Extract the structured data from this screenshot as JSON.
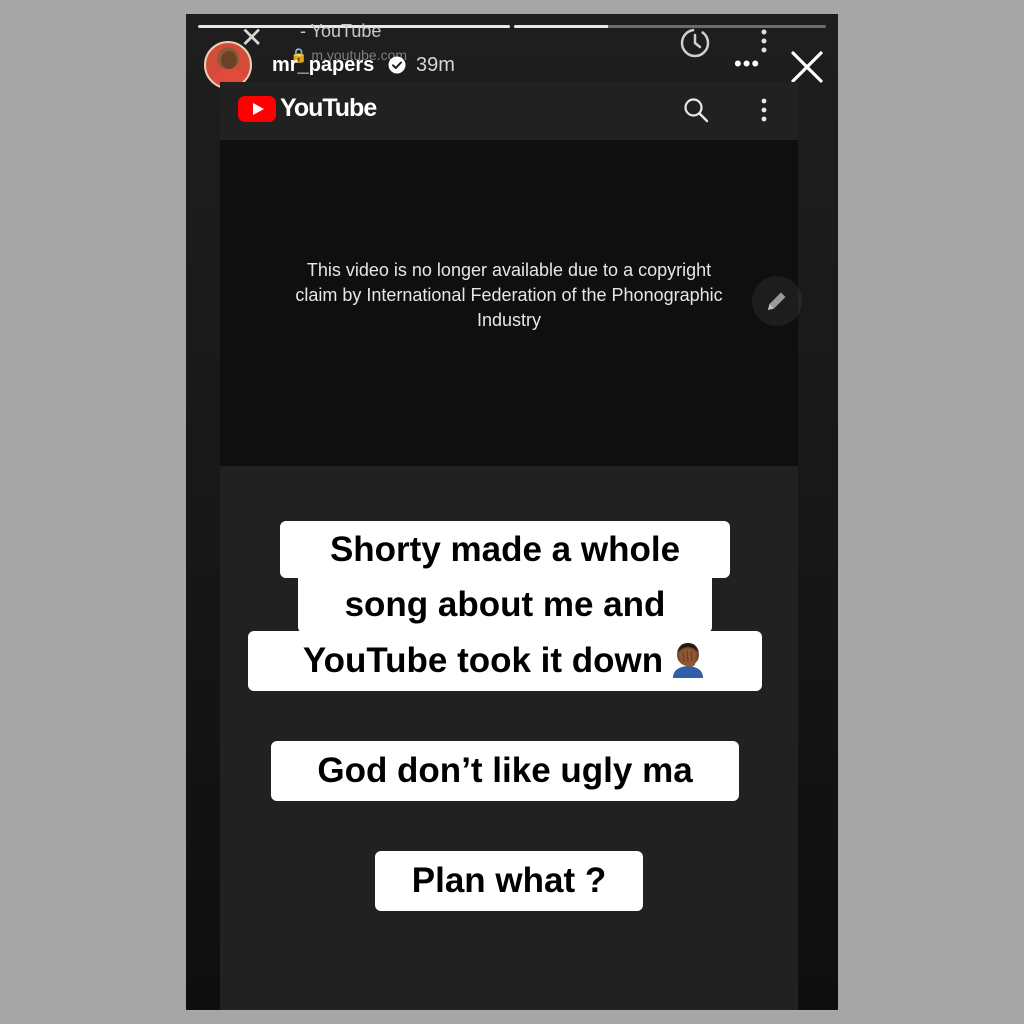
{
  "progress": [
    1,
    0.3
  ],
  "browser_chrome": {
    "tab_title": "- YouTube",
    "url": "m.youtube.com"
  },
  "story": {
    "username": "mr_papers",
    "time_ago": "39m",
    "verified": true
  },
  "youtube": {
    "logo_text": "YouTube",
    "player_message": "This video is no longer available due to a copyright claim by International Federation of the Phonographic Industry",
    "player_message_lines": [
      "This video is no longer available due to a copyright",
      "claim by International Federation of the Phonographic",
      "Industry"
    ]
  },
  "captions": [
    "Shorty made a whole",
    "song about me and",
    "YouTube took it down",
    "God don’t like ugly ma",
    "Plan what ?"
  ],
  "icons": {
    "more": "more-horizontal-icon",
    "close": "close-icon",
    "search": "search-icon",
    "menu": "kebab-menu-icon",
    "edit": "pencil-icon",
    "emoji": "facepalm-emoji-icon"
  },
  "colors": {
    "youtube_red": "#ff0000",
    "background": "#212121",
    "player": "#0f0f0f"
  }
}
